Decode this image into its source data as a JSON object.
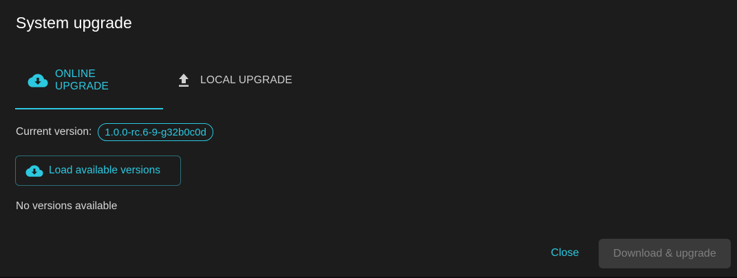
{
  "dialog": {
    "title": "System upgrade"
  },
  "tabs": [
    {
      "label": "ONLINE UPGRADE",
      "icon": "cloud-download-icon",
      "active": true
    },
    {
      "label": "LOCAL UPGRADE",
      "icon": "upload-icon",
      "active": false
    }
  ],
  "version": {
    "label": "Current version:",
    "value": "1.0.0-rc.6-9-g32b0c0d"
  },
  "load_button": {
    "label": "Load available versions",
    "icon": "cloud-download-icon"
  },
  "status": {
    "text": "No versions available"
  },
  "actions": {
    "close_label": "Close",
    "download_label": "Download & upgrade"
  },
  "colors": {
    "accent": "#2cc8e0",
    "background": "#1c1c1c",
    "disabled_bg": "#3a3a3a",
    "disabled_text": "#7f7f7f"
  }
}
